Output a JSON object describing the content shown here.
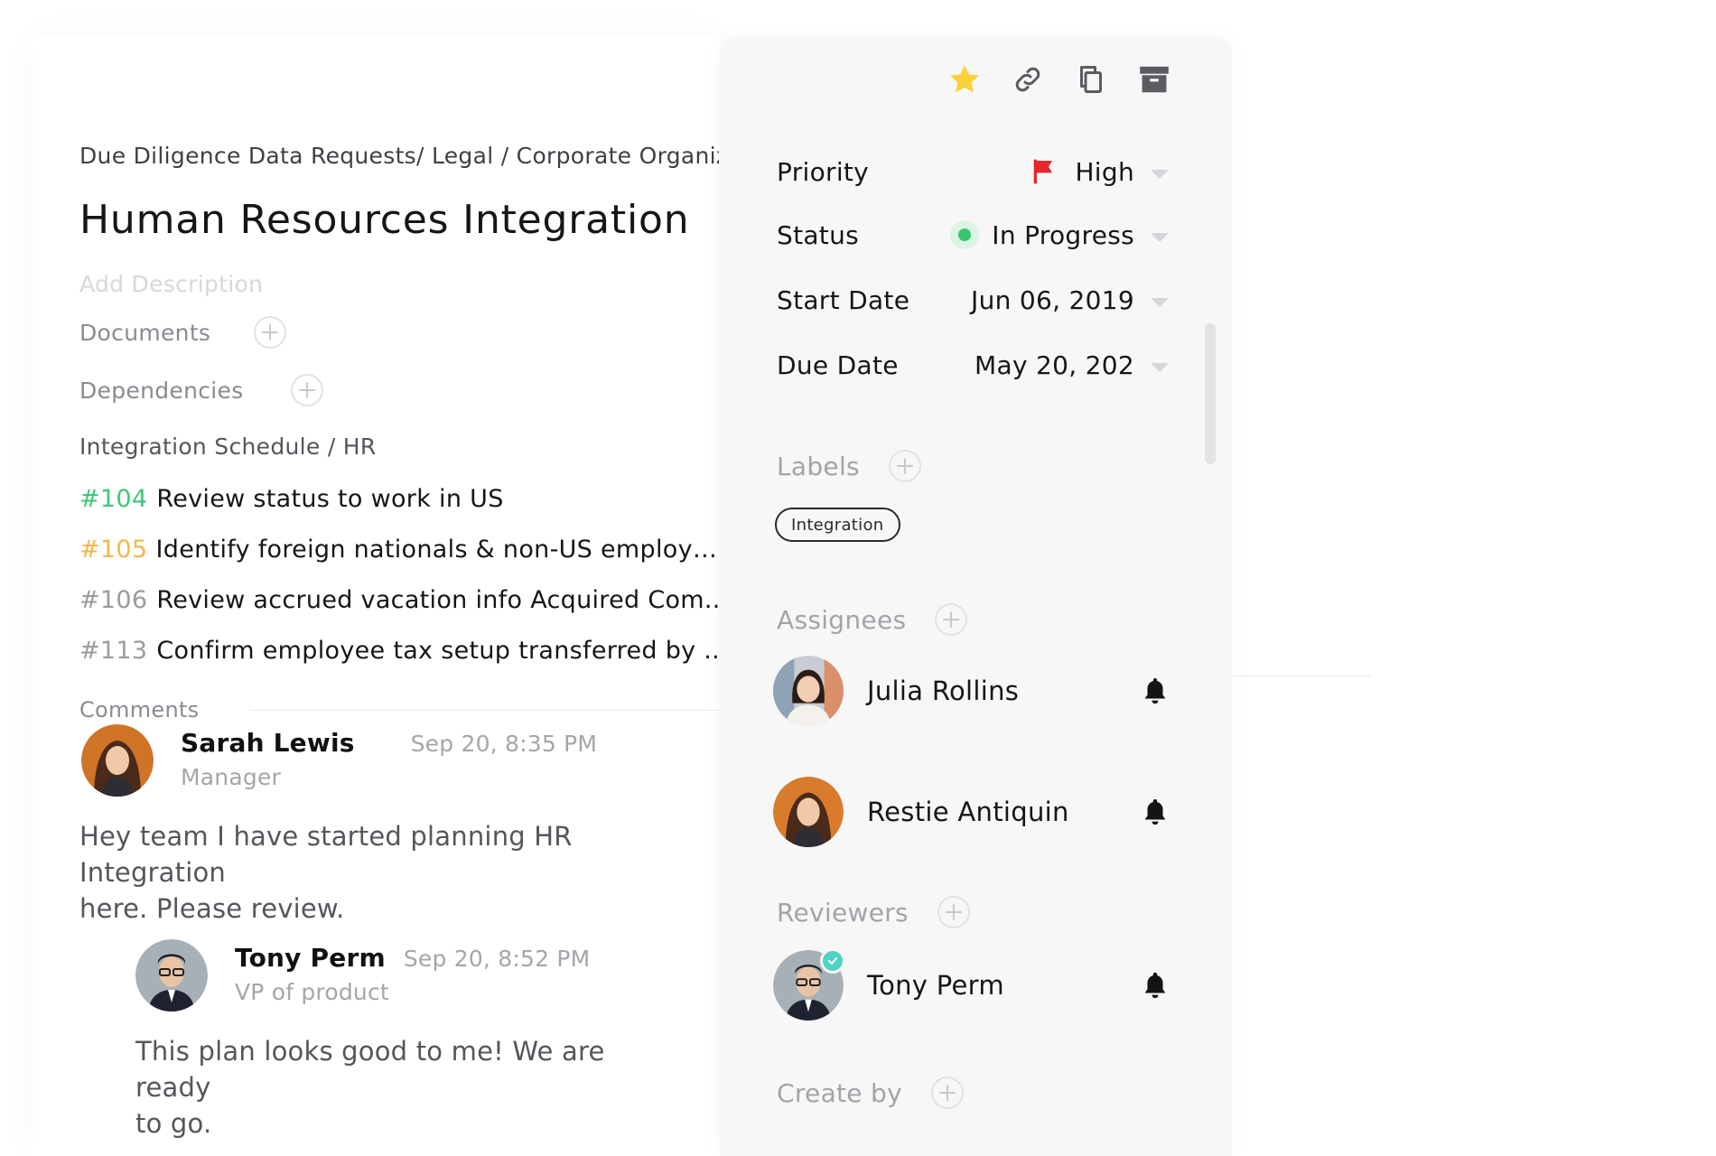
{
  "breadcrumb": "Due Diligence Data Requests/ Legal / Corporate Organizc",
  "title": "Human Resources Integration",
  "add_description": "Add Description",
  "sections": {
    "documents": "Documents",
    "dependencies": "Dependencies",
    "schedule": "Integration Schedule / HR",
    "comments": "Comments"
  },
  "tasks": [
    {
      "id": "#104",
      "title": "Review status to work in US",
      "id_color": "#3fc776"
    },
    {
      "id": "#105",
      "title": "Identify foreign nationals & non-US employees",
      "id_color": "#f2b84b"
    },
    {
      "id": "#106",
      "title": "Review accrued vacation info Acquired Com...",
      "id_color": "#9a9aa0"
    },
    {
      "id": "#113",
      "title": "Confirm employee tax setup transferred by ...",
      "id_color": "#9a9aa0"
    }
  ],
  "comments": [
    {
      "author": "Sarah Lewis",
      "time": "Sep 20, 8:35 PM",
      "role": "Manager",
      "body_line1": "Hey team I have started planning HR Integration",
      "body_line2": "here. Please review."
    },
    {
      "author": "Tony Perm",
      "time": "Sep 20, 8:52 PM",
      "role": "VP of product",
      "body_line1": "This plan looks good to me! We are ready",
      "body_line2": "to go."
    }
  ],
  "panel": {
    "toolbar": [
      "star-icon",
      "link-icon",
      "copy-icon",
      "archive-icon"
    ],
    "priority": {
      "label": "Priority",
      "value": "High",
      "flag_color": "#e8262b"
    },
    "status": {
      "label": "Status",
      "value": "In Progress",
      "dot_color": "#35c66b"
    },
    "start_date": {
      "label": "Start Date",
      "value": "Jun 06, 2019"
    },
    "due_date": {
      "label": "Due Date",
      "value": "May 20, 202"
    },
    "labels": {
      "label": "Labels",
      "chips": [
        "Integration"
      ]
    },
    "assignees": {
      "label": "Assignees",
      "people": [
        {
          "name": "Julia Rollins"
        },
        {
          "name": "Restie Antiquin"
        }
      ]
    },
    "reviewers": {
      "label": "Reviewers",
      "people": [
        {
          "name": "Tony Perm",
          "verified": true
        }
      ]
    },
    "created_by": {
      "label": "Create by"
    }
  },
  "colors": {
    "star": "#fbd13a",
    "accent_green": "#3fc776",
    "accent_yellow": "#f2b84b",
    "panel_bg": "#f7f7f8"
  }
}
